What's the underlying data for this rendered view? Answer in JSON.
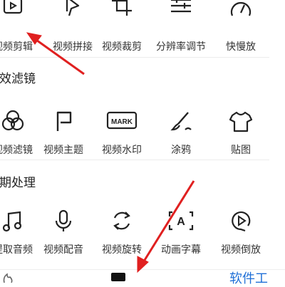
{
  "sections": [
    {
      "title": "",
      "items": [
        {
          "label": "视频剪辑",
          "icon": "video-edit-icon"
        },
        {
          "label": "视频拼接",
          "icon": "video-merge-icon"
        },
        {
          "label": "视频裁剪",
          "icon": "crop-icon"
        },
        {
          "label": "分辨率调节",
          "icon": "resolution-sliders-icon"
        },
        {
          "label": "快慢放",
          "icon": "speed-gauge-icon"
        }
      ]
    },
    {
      "title": "特效滤镜",
      "items": [
        {
          "label": "视频滤镜",
          "icon": "filter-icon"
        },
        {
          "label": "视频主题",
          "icon": "theme-flag-icon"
        },
        {
          "label": "视频水印",
          "icon": "watermark-mark-icon",
          "badge": "MARK"
        },
        {
          "label": "涂鸦",
          "icon": "brush-icon"
        },
        {
          "label": "贴图",
          "icon": "tshirt-sticker-icon"
        }
      ]
    },
    {
      "title": "后期处理",
      "items": [
        {
          "label": "提取音频",
          "icon": "music-note-icon"
        },
        {
          "label": "视频配音",
          "icon": "microphone-icon"
        },
        {
          "label": "视频旋转",
          "icon": "rotate-icon"
        },
        {
          "label": "动画字幕",
          "icon": "animated-caption-icon",
          "badge": "A"
        },
        {
          "label": "视频倒放",
          "icon": "reverse-play-icon"
        }
      ]
    }
  ],
  "bottom_nav": {
    "right_text": "软件工"
  },
  "annotation_color": "#e02020"
}
